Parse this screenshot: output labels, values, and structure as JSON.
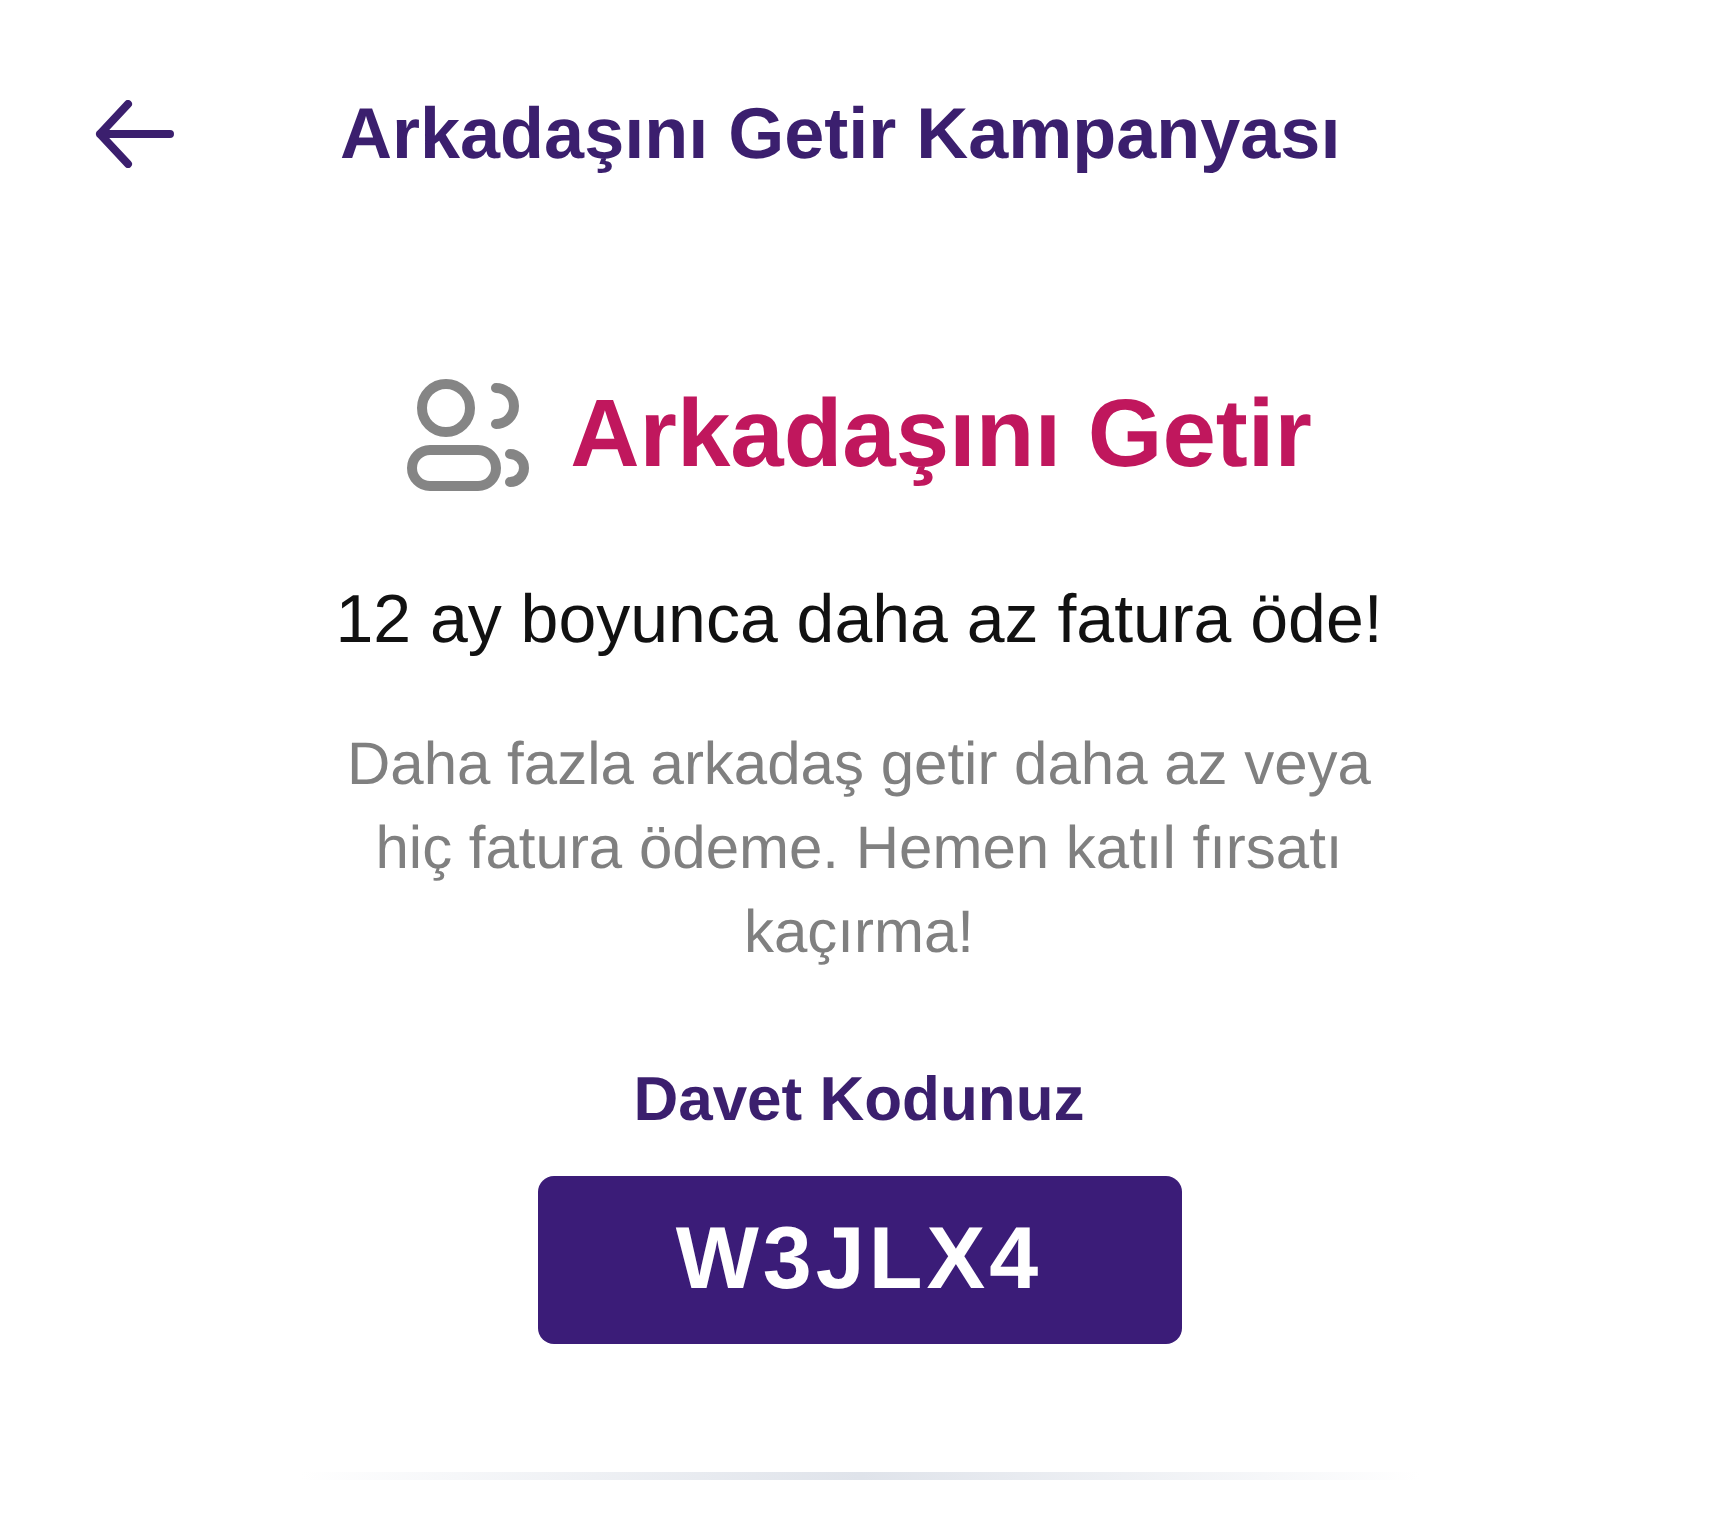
{
  "header": {
    "title": "Arkadaşını Getir Kampanyası"
  },
  "campaign": {
    "heading": "Arkadaşını Getir",
    "subtitle": "12 ay boyunca daha az fatura öde!",
    "description": "Daha fazla arkadaş getir daha az veya hiç fatura ödeme. Hemen katıl fırsatı kaçırma!"
  },
  "invite": {
    "label": "Davet Kodunuz",
    "code": "W3JLX4"
  }
}
